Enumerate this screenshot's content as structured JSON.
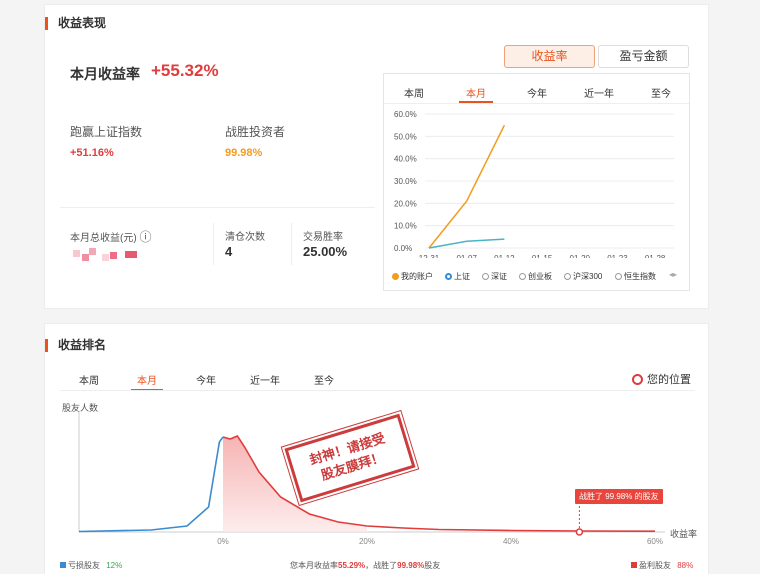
{
  "perf": {
    "title": "收益表现",
    "month_rate_label": "本月收益率",
    "month_rate_value": "+55.32%",
    "beat_index_label": "跑赢上证指数",
    "beat_index_value": "+51.16%",
    "beat_investors_label": "战胜投资者",
    "beat_investors_value": "99.98%",
    "total_profit_label": "本月总收益(元)",
    "info_icon": "ⓘ",
    "clear_count_label": "清仓次数",
    "clear_count_value": "4",
    "win_rate_label": "交易胜率",
    "win_rate_value": "25.00%",
    "toggle": [
      "收益率",
      "盈亏金额"
    ],
    "periods": [
      "本周",
      "本月",
      "今年",
      "近一年",
      "至今"
    ],
    "legend": [
      "我的账户",
      "上证",
      "深证",
      "创业板",
      "沪深300",
      "恒生指数"
    ],
    "legend_more_icon": "◂▸"
  },
  "rank": {
    "title": "收益排名",
    "periods": [
      "本周",
      "本月",
      "今年",
      "近一年",
      "至今"
    ],
    "your_position": "您的位置",
    "ylabel": "股友人数",
    "xlabel": "收益率",
    "tooltip": "战胜了 99.98% 的股友",
    "stamp_line1": "封神！请接受",
    "stamp_line2": "股友膜拜！",
    "loss_label": "亏损股友",
    "loss_value": "12%",
    "profit_label": "盈利股友",
    "profit_value": "88%",
    "summary_a": "您本月收益率",
    "summary_b": "55.29%",
    "summary_c": "，战胜了",
    "summary_d": "99.98%",
    "summary_e": "股友"
  },
  "colors": {
    "accent": "#e8541e",
    "red": "#e03c3c",
    "orange": "#f29c1f",
    "teal": "#4ab3c7",
    "blue": "#3b8bd0",
    "green": "#3aa64c"
  },
  "chart_data": [
    {
      "type": "line",
      "x": [
        "12-31",
        "01-07",
        "01-12",
        "01-15",
        "01-20",
        "01-23",
        "01-28"
      ],
      "ylim": [
        0,
        60
      ],
      "yticks": [
        "60.0%",
        "50.0%",
        "40.0%",
        "30.0%",
        "20.0%",
        "10.0%",
        "0.0%"
      ],
      "series": [
        {
          "name": "我的账户",
          "values": [
            0,
            21,
            55,
            null,
            null,
            null,
            null
          ]
        },
        {
          "name": "上证",
          "values": [
            0,
            3,
            4,
            null,
            null,
            null,
            null
          ]
        }
      ],
      "grid": true,
      "legend": "bottom"
    },
    {
      "type": "area",
      "xlabel": "收益率",
      "ylabel": "股友人数",
      "xticks": [
        "0%",
        "20%",
        "40%",
        "60%"
      ],
      "x": [
        -20,
        -10,
        -5,
        -2,
        -0.5,
        0,
        1,
        2,
        3,
        5,
        8,
        12,
        16,
        20,
        25,
        30,
        40,
        50,
        60
      ],
      "y": [
        0.5,
        2,
        6,
        25,
        90,
        95,
        93,
        96,
        85,
        60,
        35,
        18,
        10,
        6,
        4,
        2.5,
        1.5,
        1,
        0.8
      ],
      "marker": {
        "x": 49.5,
        "label": "战胜了 99.98% 的股友"
      }
    }
  ]
}
